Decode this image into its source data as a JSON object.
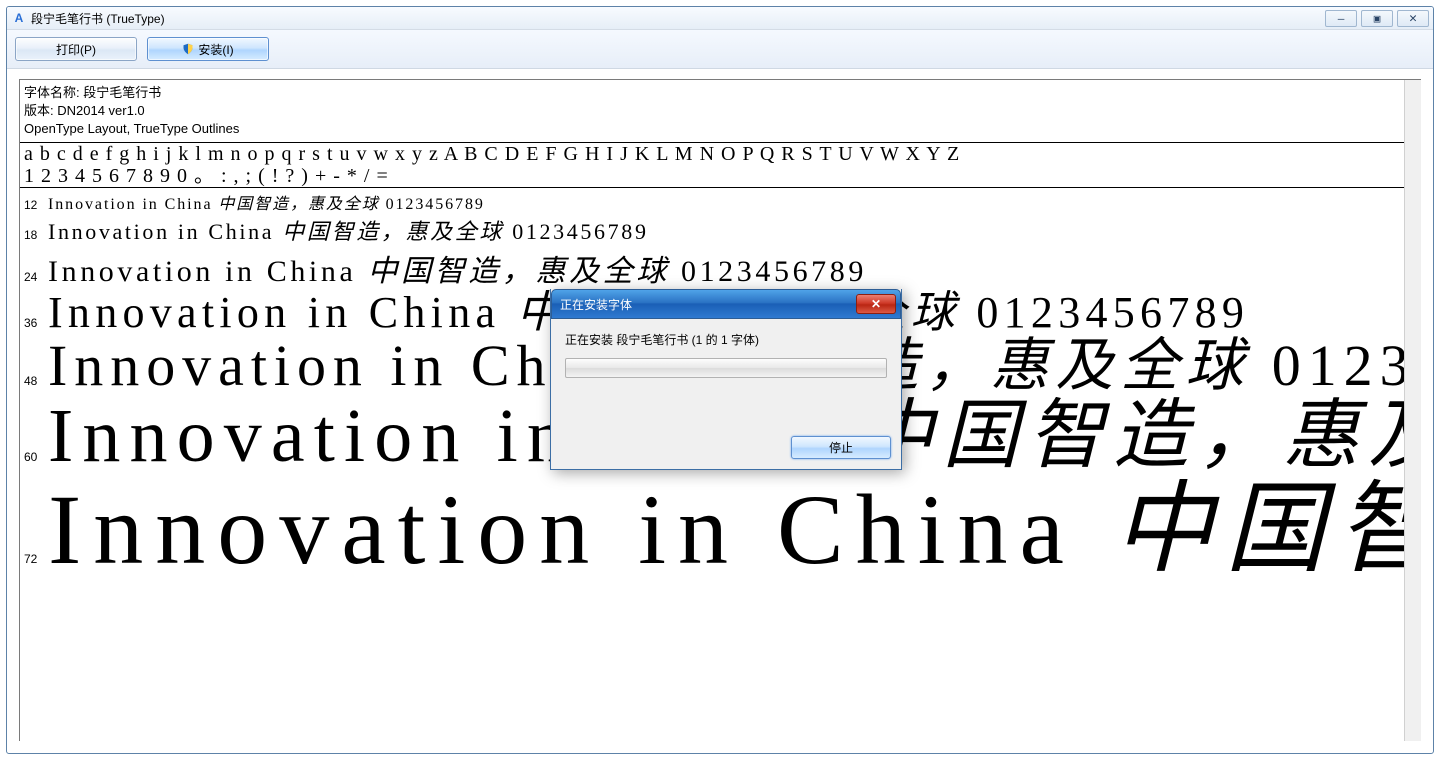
{
  "window": {
    "title": "段宁毛笔行书 (TrueType)",
    "min_label": "—",
    "max_label": "▣",
    "close_label": "✕"
  },
  "toolbar": {
    "print_label": "打印(P)",
    "install_label": "安装(I)"
  },
  "info": {
    "name_line": "字体名称: 段宁毛笔行书",
    "version_line": "版本: DN2014 ver1.0",
    "tech_line": "OpenType Layout, TrueType Outlines"
  },
  "glyphs": {
    "line1": "a b c d e f g h i j k l m n o p q r s t u v w x y z   A B C D E F G H I J K L M N O P Q R S T U V W X Y Z",
    "line2": "1 2 3 4 5 6 7 8 9 0 。 : , ;         ( ! ? )   + - * / ="
  },
  "samples": {
    "latin": "Innovation in China ",
    "chinese": "中国智造，惠及全球 ",
    "digits": "0123456789",
    "sizes": [
      {
        "label": "12"
      },
      {
        "label": "18"
      },
      {
        "label": "24"
      },
      {
        "label": "36"
      },
      {
        "label": "48"
      },
      {
        "label": "60"
      },
      {
        "label": "72"
      }
    ]
  },
  "dialog": {
    "open": true,
    "title": "正在安装字体",
    "message": "正在安装 段宁毛笔行书 (1 的 1 字体)",
    "stop_label": "停止",
    "close_label": "✕"
  }
}
